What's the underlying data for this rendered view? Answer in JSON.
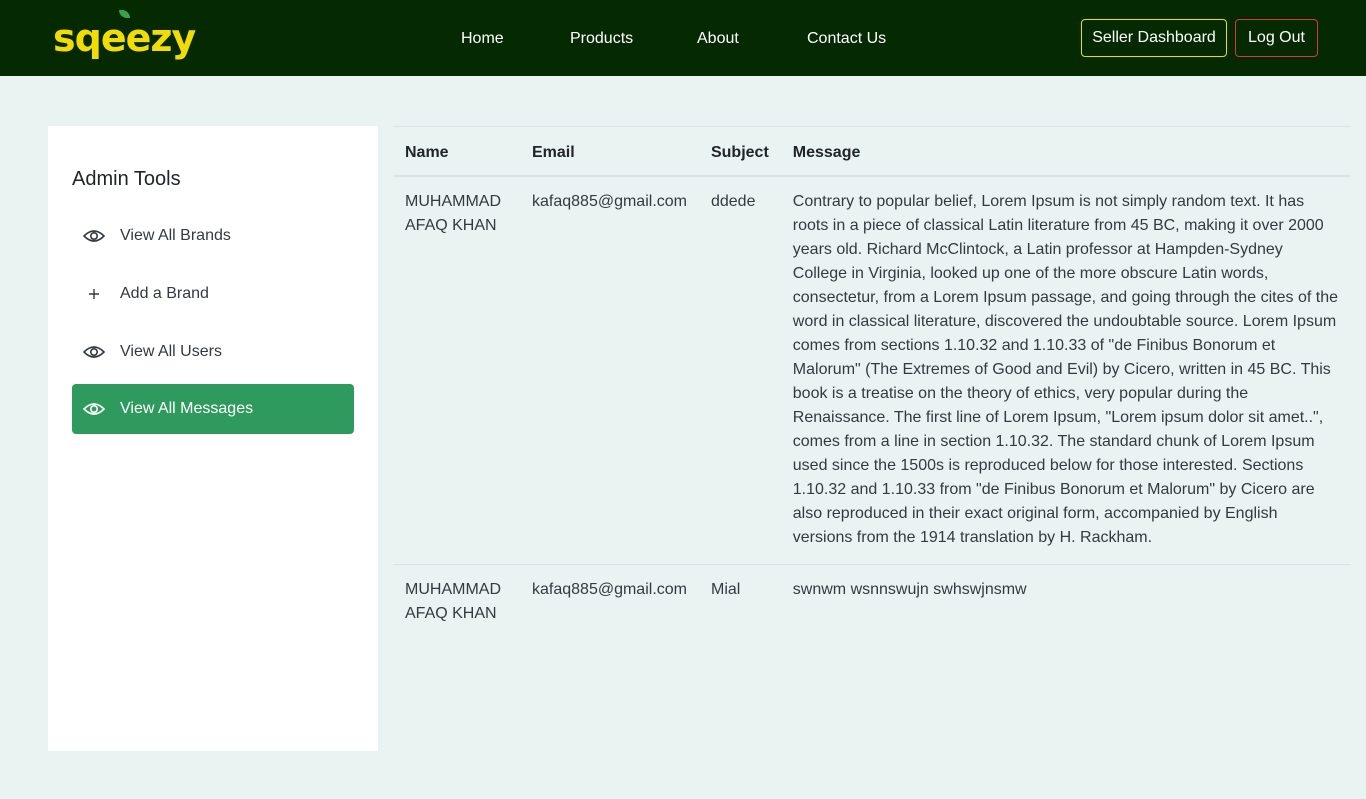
{
  "brand": {
    "logo_text": "sqeezy",
    "logo_color": "#f2dc05"
  },
  "nav": {
    "links": [
      "Home",
      "Products",
      "About",
      "Contact Us"
    ],
    "seller_dashboard": "Seller Dashboard",
    "logout": "Log Out"
  },
  "sidebar": {
    "title": "Admin Tools",
    "items": [
      {
        "label": "View All Brands",
        "icon": "eye-icon",
        "active": false
      },
      {
        "label": "Add a Brand",
        "icon": "plus-icon",
        "active": false
      },
      {
        "label": "View All Users",
        "icon": "eye-icon",
        "active": false
      },
      {
        "label": "View All Messages",
        "icon": "eye-icon",
        "active": true
      }
    ]
  },
  "table": {
    "headers": [
      "Name",
      "Email",
      "Subject",
      "Message"
    ],
    "rows": [
      {
        "name": "MUHAMMAD AFAQ KHAN",
        "email": "kafaq885@gmail.com",
        "subject": "ddede",
        "message": "Contrary to popular belief, Lorem Ipsum is not simply random text. It has roots in a piece of classical Latin literature from 45 BC, making it over 2000 years old. Richard McClintock, a Latin professor at Hampden-Sydney College in Virginia, looked up one of the more obscure Latin words, consectetur, from a Lorem Ipsum passage, and going through the cites of the word in classical literature, discovered the undoubtable source. Lorem Ipsum comes from sections 1.10.32 and 1.10.33 of \"de Finibus Bonorum et Malorum\" (The Extremes of Good and Evil) by Cicero, written in 45 BC. This book is a treatise on the theory of ethics, very popular during the Renaissance. The first line of Lorem Ipsum, \"Lorem ipsum dolor sit amet..\", comes from a line in section 1.10.32. The standard chunk of Lorem Ipsum used since the 1500s is reproduced below for those interested. Sections 1.10.32 and 1.10.33 from \"de Finibus Bonorum et Malorum\" by Cicero are also reproduced in their exact original form, accompanied by English versions from the 1914 translation by H. Rackham."
      },
      {
        "name": "MUHAMMAD AFAQ KHAN",
        "email": "kafaq885@gmail.com",
        "subject": "Mial",
        "message": "swnwm wsnnswujn swhswjnsmw"
      }
    ]
  },
  "colors": {
    "navbar_bg": "#052a02",
    "page_bg": "#e9f3f1",
    "active_item": "#2f9a5d",
    "seller_border": "#f2dc05",
    "logout_border": "#dc3545"
  }
}
